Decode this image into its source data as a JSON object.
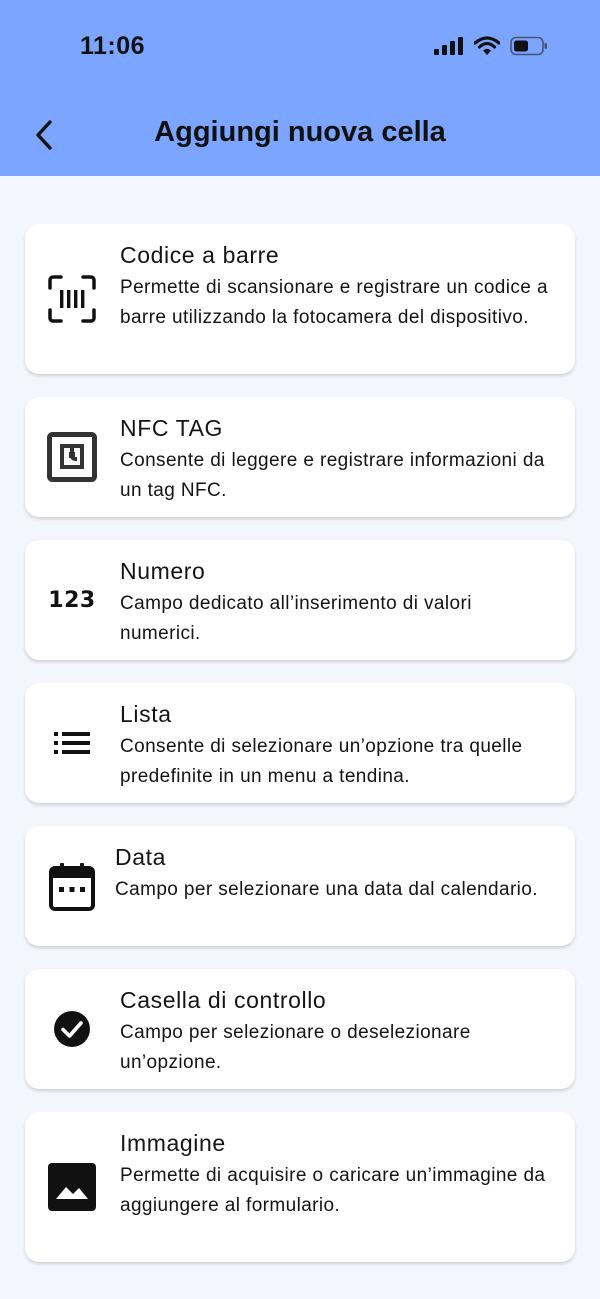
{
  "status_bar": {
    "time": "11:06",
    "icons": [
      "cellular-signal-icon",
      "wifi-icon",
      "battery-icon"
    ]
  },
  "header": {
    "title": "Aggiungi nuova cella",
    "back_icon": "chevron-left-icon",
    "background": "#7BA5FF"
  },
  "items": [
    {
      "icon": "barcode-scan-icon",
      "label": "Codice a barre",
      "desc": "Permette di scansionare e registrare un codice a barre utilizzando la fotocamera del dispositivo."
    },
    {
      "icon": "nfc-icon",
      "label": "NFC TAG",
      "desc": "Consente di leggere e registrare informazioni da un tag NFC."
    },
    {
      "icon": "numbers-icon",
      "icon_text": "123",
      "label": "Numero",
      "desc": "Campo dedicato all’inserimento di valori numerici."
    },
    {
      "icon": "list-icon",
      "label": "Lista",
      "desc": "Consente di selezionare un’opzione tra quelle predefinite in un menu a tendina."
    },
    {
      "icon": "calendar-icon",
      "label": "Data",
      "desc": "Campo per selezionare una data dal calendario."
    },
    {
      "icon": "check-circle-icon",
      "label": "Casella di controllo",
      "desc": "Campo per selezionare o deselezionare un’opzione."
    },
    {
      "icon": "image-icon",
      "label": "Immagine",
      "desc": "Permette di acquisire o caricare un’immagine da aggiungere al formulario."
    }
  ]
}
